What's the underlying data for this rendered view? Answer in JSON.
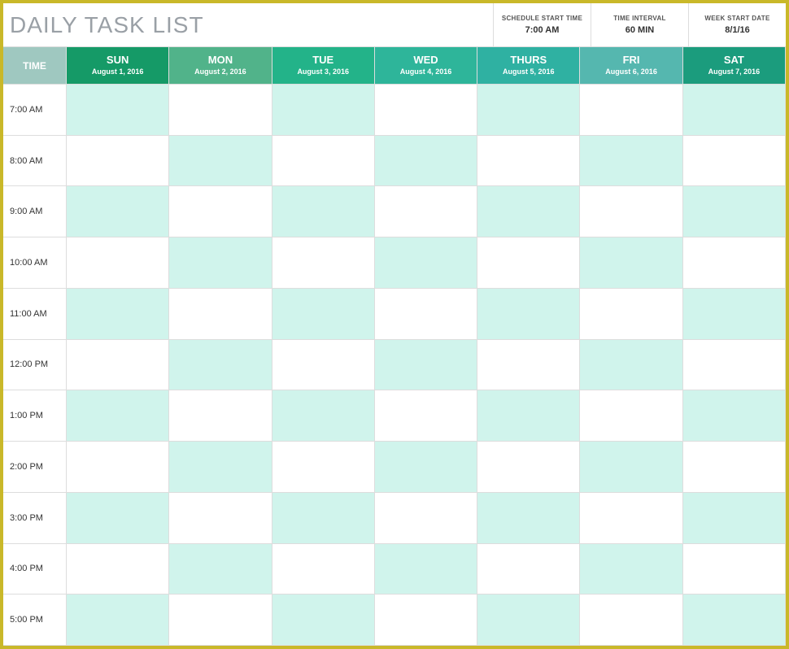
{
  "title": "DAILY TASK LIST",
  "meta": [
    {
      "label": "SCHEDULE START TIME",
      "value": "7:00 AM"
    },
    {
      "label": "TIME INTERVAL",
      "value": "60 MIN"
    },
    {
      "label": "WEEK START DATE",
      "value": "8/1/16"
    }
  ],
  "timeHeader": "TIME",
  "days": [
    {
      "name": "SUN",
      "date": "August 1, 2016",
      "cls": "hdr-sun"
    },
    {
      "name": "MON",
      "date": "August 2, 2016",
      "cls": "hdr-mon"
    },
    {
      "name": "TUE",
      "date": "August 3, 2016",
      "cls": "hdr-tue"
    },
    {
      "name": "WED",
      "date": "August 4, 2016",
      "cls": "hdr-wed"
    },
    {
      "name": "THURS",
      "date": "August 5, 2016",
      "cls": "hdr-thu"
    },
    {
      "name": "FRI",
      "date": "August 6, 2016",
      "cls": "hdr-fri"
    },
    {
      "name": "SAT",
      "date": "August 7, 2016",
      "cls": "hdr-sat"
    }
  ],
  "times": [
    "7:00 AM",
    "8:00 AM",
    "9:00 AM",
    "10:00 AM",
    "11:00 AM",
    "12:00 PM",
    "1:00 PM",
    "2:00 PM",
    "3:00 PM",
    "4:00 PM",
    "5:00 PM"
  ]
}
